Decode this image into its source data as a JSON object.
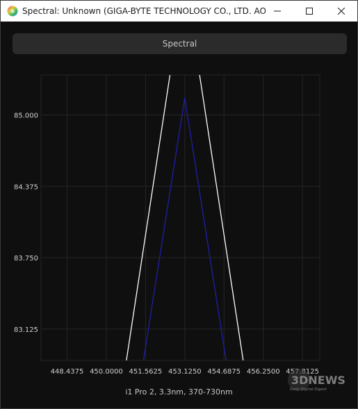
{
  "window": {
    "title": "Spectral: Unknown (GIGA-BYTE TECHNOLOGY CO., LTD. AORUS..."
  },
  "toolbar": {
    "spectral_label": "Spectral"
  },
  "caption": "i1 Pro 2, 3.3nm, 370-730nm",
  "watermark": {
    "brand": "3DNEWS",
    "tagline": "Daily Digital Digest"
  },
  "colors": {
    "background": "#0f0f0f",
    "grid": "#262626",
    "white_series": "#ffffff",
    "blue_series": "#1f1fa8"
  },
  "chart_data": {
    "type": "line",
    "title": "",
    "xlabel": "",
    "ylabel": "",
    "xlim": [
      447.4,
      458.5
    ],
    "ylim": [
      82.85,
      85.35
    ],
    "x_ticks": [
      "448.4375",
      "450.0000",
      "451.5625",
      "453.1250",
      "454.6875",
      "456.2500",
      "457.8125"
    ],
    "y_ticks": [
      "85.000",
      "84.375",
      "83.750",
      "83.125"
    ],
    "grid": true,
    "series": [
      {
        "color": "#ffffff",
        "x": [
          450.8,
          453.125,
          455.45
        ],
        "y": [
          82.85,
          86.2,
          82.85
        ]
      },
      {
        "color": "#1f1fa8",
        "x": [
          451.48,
          453.125,
          454.77
        ],
        "y": [
          82.85,
          85.15,
          82.85
        ]
      }
    ]
  }
}
